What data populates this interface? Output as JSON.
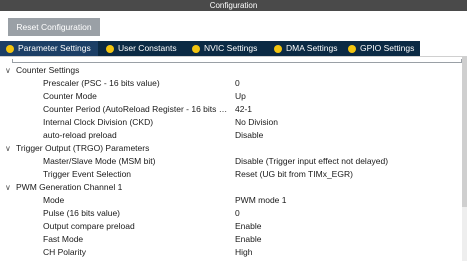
{
  "window": {
    "title": "Configuration"
  },
  "toolbar": {
    "reset_label": "Reset Configuration"
  },
  "tabs": [
    {
      "label": "Parameter Settings",
      "active": true
    },
    {
      "label": "User Constants",
      "active": false
    },
    {
      "label": "NVIC Settings",
      "active": false
    },
    {
      "label": "DMA Settings",
      "active": false
    },
    {
      "label": "GPIO Settings",
      "active": false
    }
  ],
  "groups": [
    {
      "label": "Counter Settings",
      "params": [
        {
          "label": "Prescaler (PSC - 16 bits value)",
          "value": "0"
        },
        {
          "label": "Counter Mode",
          "value": "Up"
        },
        {
          "label": "Counter Period (AutoReload Register - 16 bits val...",
          "value": "42-1"
        },
        {
          "label": "Internal Clock Division (CKD)",
          "value": "No Division"
        },
        {
          "label": "auto-reload preload",
          "value": "Disable"
        }
      ]
    },
    {
      "label": "Trigger Output (TRGO) Parameters",
      "params": [
        {
          "label": "Master/Slave Mode (MSM bit)",
          "value": "Disable (Trigger input effect not delayed)"
        },
        {
          "label": "Trigger Event Selection",
          "value": "Reset (UG bit from TIMx_EGR)"
        }
      ]
    },
    {
      "label": "PWM Generation Channel 1",
      "params": [
        {
          "label": "Mode",
          "value": "PWM mode 1"
        },
        {
          "label": "Pulse (16 bits value)",
          "value": "0"
        },
        {
          "label": "Output compare preload",
          "value": "Enable"
        },
        {
          "label": "Fast Mode",
          "value": "Enable"
        },
        {
          "label": "CH Polarity",
          "value": "High"
        }
      ]
    }
  ],
  "colors": {
    "titlebar": "#4a4a4a",
    "tabbar": "#0b2a44",
    "tab_active": "#1c3f66",
    "tab_dot": "#f2c40f",
    "reset_button": "#9aa0a6"
  },
  "icons": {
    "tab_status": "yellow-dot-icon",
    "group_toggle": "collapse-chevron-icon"
  }
}
